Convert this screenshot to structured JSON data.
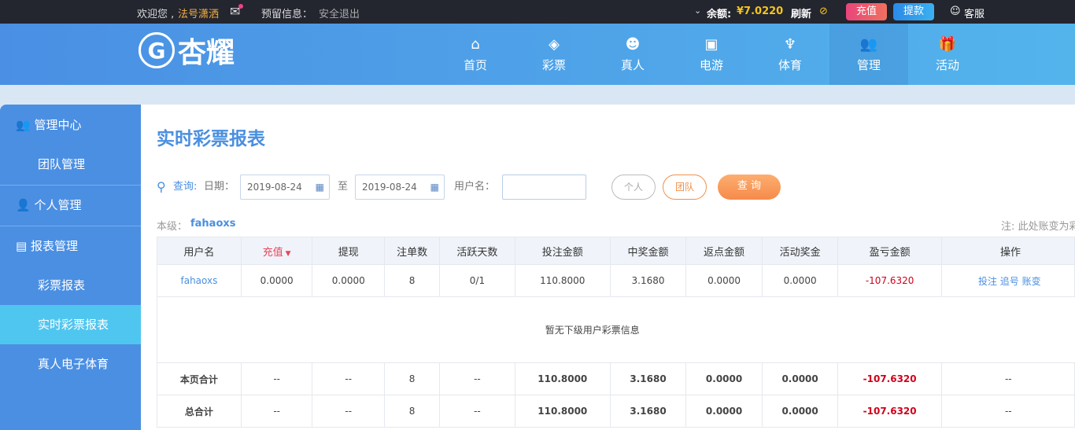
{
  "topbar": {
    "welcome": "欢迎您 ,",
    "nickname": "法号潇洒",
    "reserved": "预留信息：",
    "logout": "安全退出",
    "balance_label": "余额:",
    "balance": "¥7.0220",
    "refresh": "刷新",
    "recharge": "充值",
    "withdraw": "提款",
    "service": "客服"
  },
  "logo": {
    "text": "杏耀"
  },
  "nav": [
    {
      "label": "首页",
      "icon": "home-icon"
    },
    {
      "label": "彩票",
      "icon": "ticket-icon"
    },
    {
      "label": "真人",
      "icon": "person-icon"
    },
    {
      "label": "电游",
      "icon": "slot-icon"
    },
    {
      "label": "体育",
      "icon": "trophy-icon"
    },
    {
      "label": "管理",
      "icon": "users-icon"
    },
    {
      "label": "活动",
      "icon": "gift-icon"
    }
  ],
  "sidebar": {
    "mgmt": "管理中心",
    "team": "团队管理",
    "personal": "个人管理",
    "report": "报表管理",
    "lottery": "彩票报表",
    "realtime": "实时彩票报表",
    "live": "真人电子体育"
  },
  "page": {
    "title": "实时彩票报表",
    "query": "查询:",
    "date_label": "日期：",
    "date_from": "2019-08-24",
    "to": "至",
    "date_to": "2019-08-24",
    "user_label": "用户名：",
    "user_value": "",
    "personal": "个人",
    "team": "团队",
    "search": "查 询",
    "level_label": "本级：",
    "level_user": "fahaoxs",
    "note": "注: 此处账变为彩"
  },
  "table": {
    "headers": [
      "用户名",
      "充值",
      "提现",
      "注单数",
      "活跃天数",
      "投注金额",
      "中奖金额",
      "返点金额",
      "活动奖金",
      "盈亏金额",
      "操作"
    ],
    "row": [
      "fahaoxs",
      "0.0000",
      "0.0000",
      "8",
      "0/1",
      "110.8000",
      "3.1680",
      "0.0000",
      "0.0000",
      "-107.6320"
    ],
    "actions": [
      "投注",
      "追号",
      "账变"
    ],
    "empty": "暂无下级用户彩票信息",
    "subtotal": [
      "本页合计",
      "--",
      "--",
      "8",
      "--",
      "110.8000",
      "3.1680",
      "0.0000",
      "0.0000",
      "-107.6320",
      "--"
    ],
    "total": [
      "总合计",
      "--",
      "--",
      "8",
      "--",
      "110.8000",
      "3.1680",
      "0.0000",
      "0.0000",
      "-107.6320",
      "--"
    ]
  }
}
